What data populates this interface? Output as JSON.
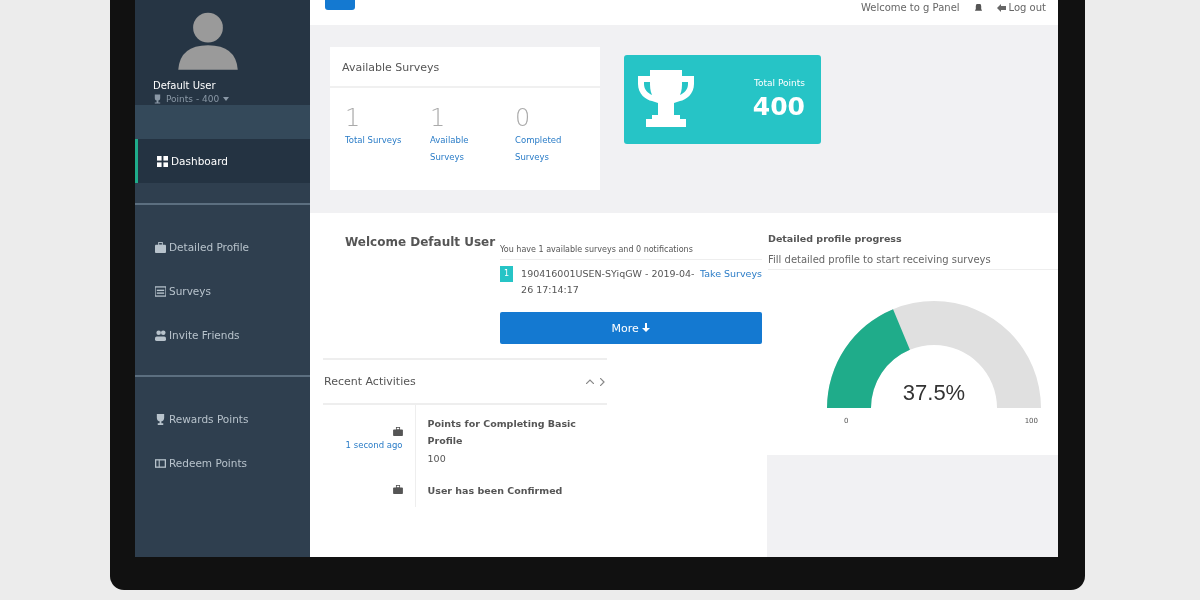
{
  "sidebar": {
    "user": {
      "name": "Default User",
      "points": "Points - 400"
    },
    "sections": [
      [
        {
          "label": "Dashboard",
          "selected": true
        }
      ],
      [
        {
          "label": "Detailed Profile",
          "selected": false
        },
        {
          "label": "Surveys",
          "selected": false
        },
        {
          "label": "Invite Friends",
          "selected": false
        }
      ],
      [
        {
          "label": "Rewards Points",
          "selected": false
        },
        {
          "label": "Redeem Points",
          "selected": false
        }
      ]
    ]
  },
  "topbar": {
    "welcome": "Welcome to g Panel",
    "logout": "Log out"
  },
  "available_surveys": {
    "title": "Available Surveys",
    "stats": [
      {
        "value": "1",
        "label": "Total Surveys"
      },
      {
        "value": "1",
        "label": "Available Surveys"
      },
      {
        "value": "0",
        "label": "Completed Surveys"
      }
    ]
  },
  "total_points": {
    "label": "Total Points",
    "value": "400"
  },
  "welcome": {
    "title": "Welcome Default User"
  },
  "notifications": {
    "summary": "You have 1 available surveys and 0 notifications",
    "items": [
      {
        "badge": "1",
        "text": "190416001USEN-SYiqGW - 2019-04-26 17:14:17",
        "link": "Take Surveys"
      }
    ],
    "more_button": "More"
  },
  "profile_progress": {
    "title": "Detailed profile progress",
    "subtitle": "Fill detailed profile to start receiving surveys",
    "level": 0.375,
    "reading": "37.5%",
    "min": "0",
    "max": "100"
  },
  "recent_activities": {
    "title": "Recent Activities",
    "items": [
      {
        "time": "1 second ago",
        "title": "Points for Completing Basic Profile",
        "value": "100"
      },
      {
        "title": "User has been Confirmed"
      }
    ]
  }
}
